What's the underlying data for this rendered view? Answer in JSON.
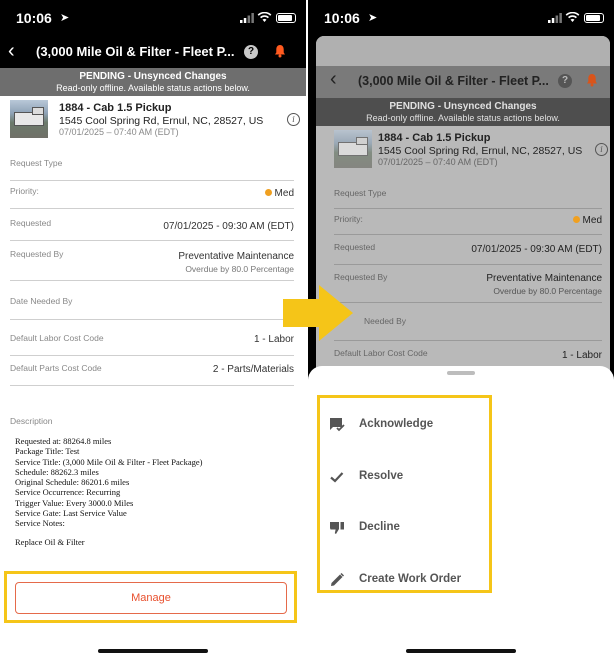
{
  "status_bar": {
    "time": "10:06"
  },
  "nav": {
    "title": "(3,000 Mile Oil & Filter - Fleet P...",
    "back_icon": "chevron-left-icon",
    "help_icon": "question-icon",
    "bell_icon": "bell-icon",
    "help_glyph": "?"
  },
  "banner": {
    "title": "PENDING - Unsynced Changes",
    "subtitle": "Read-only offline. Available status actions below."
  },
  "asset": {
    "name": "1884 - Cab 1.5 Pickup",
    "address": "1545 Cool Spring Rd, Ernul, NC, 28527, US",
    "date": "07/01/2025 – 07:40 AM (EDT)",
    "info_glyph": "i"
  },
  "fields": {
    "request_type": {
      "label": "Request Type"
    },
    "priority": {
      "label": "Priority:",
      "value": "Med",
      "color": "#f0a020"
    },
    "requested": {
      "label": "Requested",
      "value": "07/01/2025 - 09:30 AM (EDT)"
    },
    "requested_by": {
      "label": "Requested By",
      "value": "Preventative Maintenance",
      "sub": "Overdue by 80.0 Percentage"
    },
    "date_needed_by": {
      "label": "Date Needed By"
    },
    "labor_cost_code": {
      "label": "Default Labor Cost Code",
      "value": "1  - Labor"
    },
    "parts_cost_code": {
      "label": "Default Parts Cost Code",
      "value": "2 - Parts/Materials"
    }
  },
  "right_fields": {
    "date_needed_by_label": "Needed By"
  },
  "description": {
    "label": "Description",
    "lines": [
      "Requested at: 88264.8 miles",
      "Package Title: Test",
      "Service Title: (3,000 Mile Oil & Filter - Fleet Package)",
      "Schedule: 88262.3 miles",
      "Original Schedule: 86201.6 miles",
      "Service Occurrence: Recurring",
      "Trigger Value: Every 3000.0 Miles",
      "Service Gate: Last Service Value",
      "Service Notes:"
    ],
    "note": "Replace Oil & Filter"
  },
  "manage_label": "Manage",
  "actions": [
    {
      "label": "Acknowledge",
      "icon": "acknowledge-icon"
    },
    {
      "label": "Resolve",
      "icon": "checkmark-icon"
    },
    {
      "label": "Decline",
      "icon": "thumbs-down-icon"
    },
    {
      "label": "Create Work Order",
      "icon": "pencil-icon"
    }
  ],
  "colors": {
    "highlight": "#f5c518",
    "accent": "#e8502e",
    "priority_med": "#f0a020"
  }
}
